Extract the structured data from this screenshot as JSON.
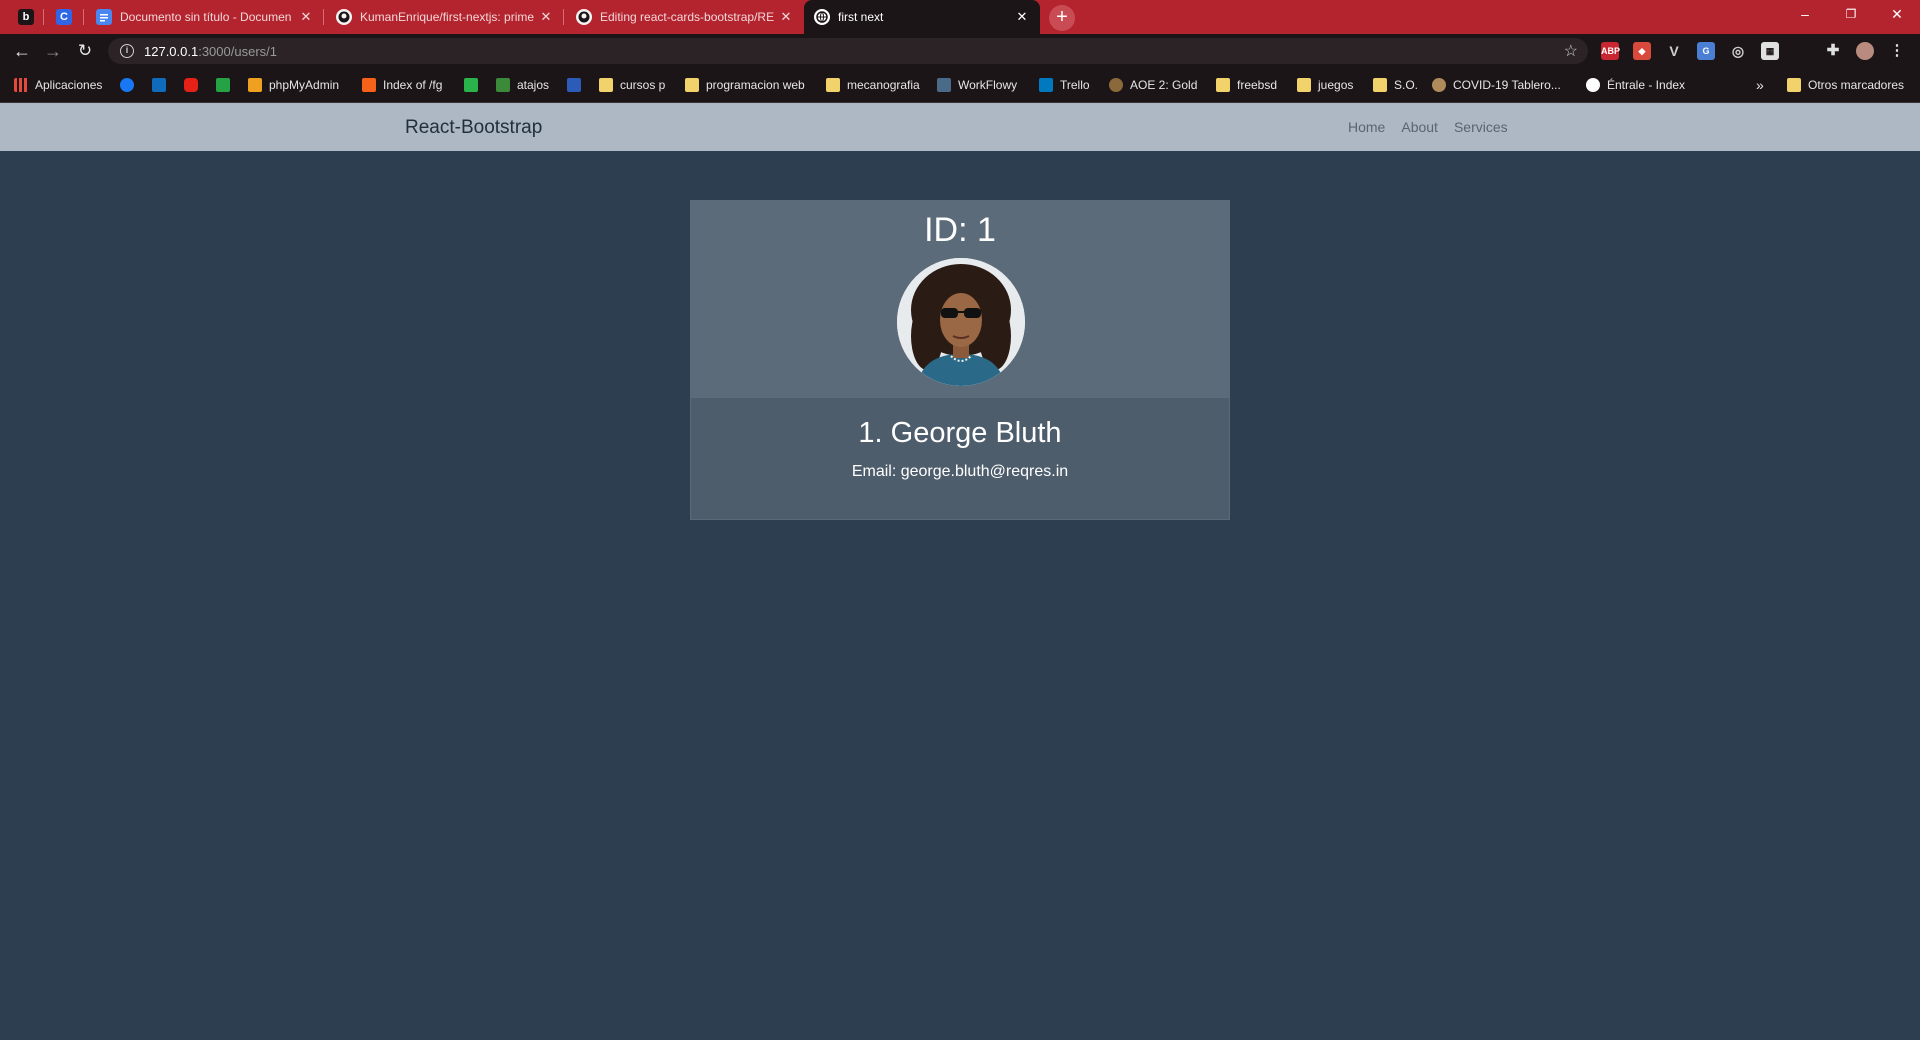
{
  "browser": {
    "tabs": [
      {
        "title": "",
        "icon": "bitwarden-icon"
      },
      {
        "title": "",
        "icon": "c-app-icon"
      },
      {
        "title": "Documento sin título - Documen",
        "icon": "google-docs-icon"
      },
      {
        "title": "KumanEnrique/first-nextjs: prime",
        "icon": "github-icon"
      },
      {
        "title": "Editing react-cards-bootstrap/RE",
        "icon": "github-icon"
      },
      {
        "title": "first next",
        "icon": "globe-icon",
        "active": true
      }
    ],
    "new_tab_label": "+",
    "window_controls": {
      "minimize": "–",
      "restore": "❐",
      "close": "✕"
    },
    "url_host": "127.0.0.1",
    "url_path": ":3000/users/1",
    "bookmarks": [
      {
        "label": "Aplicaciones",
        "icon": "apps-grid-icon"
      },
      {
        "label": "",
        "icon": "facebook-icon"
      },
      {
        "label": "",
        "icon": "outlook-icon"
      },
      {
        "label": "",
        "icon": "youtube-icon"
      },
      {
        "label": "",
        "icon": "whatsapp-icon"
      },
      {
        "label": "phpMyAdmin",
        "icon": "phpmyadmin-icon"
      },
      {
        "label": "Index of /fg",
        "icon": "xampp-icon"
      },
      {
        "label": "",
        "icon": "arrow-bookmark-icon"
      },
      {
        "label": "atajos",
        "icon": "leaf-icon"
      },
      {
        "label": "",
        "icon": "flag-icon"
      },
      {
        "label": "cursos p",
        "icon": "folder-icon"
      },
      {
        "label": "programacion web",
        "icon": "folder-icon"
      },
      {
        "label": "mecanografia",
        "icon": "folder-icon"
      },
      {
        "label": "WorkFlowy",
        "icon": "workflowy-icon"
      },
      {
        "label": "Trello",
        "icon": "trello-icon"
      },
      {
        "label": "AOE 2: Gold",
        "icon": "aoe-icon"
      },
      {
        "label": "freebsd",
        "icon": "folder-icon"
      },
      {
        "label": "juegos",
        "icon": "folder-icon"
      },
      {
        "label": "S.O.",
        "icon": "folder-icon"
      },
      {
        "label": "COVID-19 Tablero...",
        "icon": "covid-icon"
      },
      {
        "label": "Éntrale - Index",
        "icon": "globe-icon"
      }
    ],
    "bookmarks_overflow": "»",
    "other_bookmarks": "Otros marcadores",
    "extensions": [
      "adblock-icon",
      "extension-icon",
      "vue-devtools-icon",
      "translate-icon",
      "target-icon",
      "calculator-icon",
      "puzzle-icon",
      "profile-avatar-icon",
      "menu-dots-icon"
    ]
  },
  "navbar": {
    "brand": "React-Bootstrap",
    "links": [
      "Home",
      "About",
      "Services"
    ]
  },
  "card": {
    "id_text": "ID: 1",
    "name": "1. George Bluth",
    "email": "Email: george.bluth@reqres.in",
    "avatar": "user-avatar-photo"
  },
  "colors": {
    "page_background": "#2c3e50",
    "navbar_background": "#aeb7c4",
    "card_header": "#5b6b7a",
    "card_body": "#4e5d6c",
    "tab_strip": "#b3242f"
  }
}
